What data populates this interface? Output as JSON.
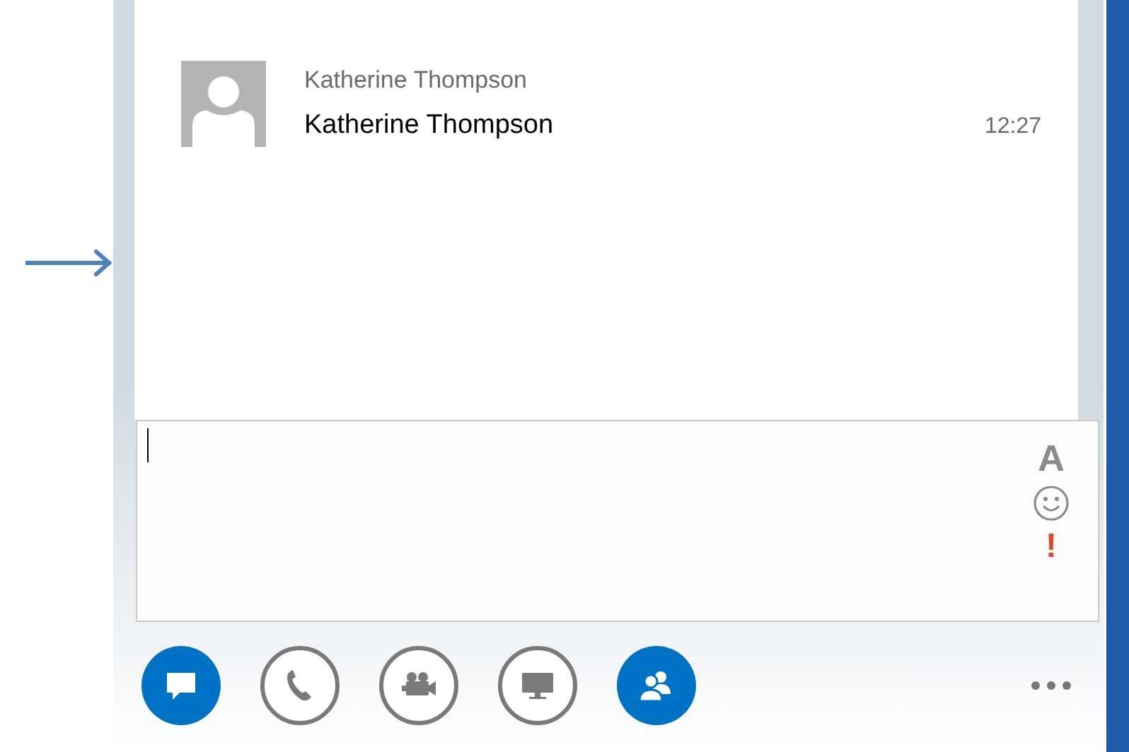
{
  "message": {
    "sender": "Katherine Thompson",
    "text": "Katherine Thompson",
    "time": "12:27"
  },
  "compose": {
    "format_label": "A",
    "importance_label": "!"
  },
  "toolbar": [
    {
      "kind": "chat",
      "active": true
    },
    {
      "kind": "phone",
      "active": false
    },
    {
      "kind": "video",
      "active": false
    },
    {
      "kind": "screen",
      "active": false
    },
    {
      "kind": "people",
      "active": true
    }
  ]
}
